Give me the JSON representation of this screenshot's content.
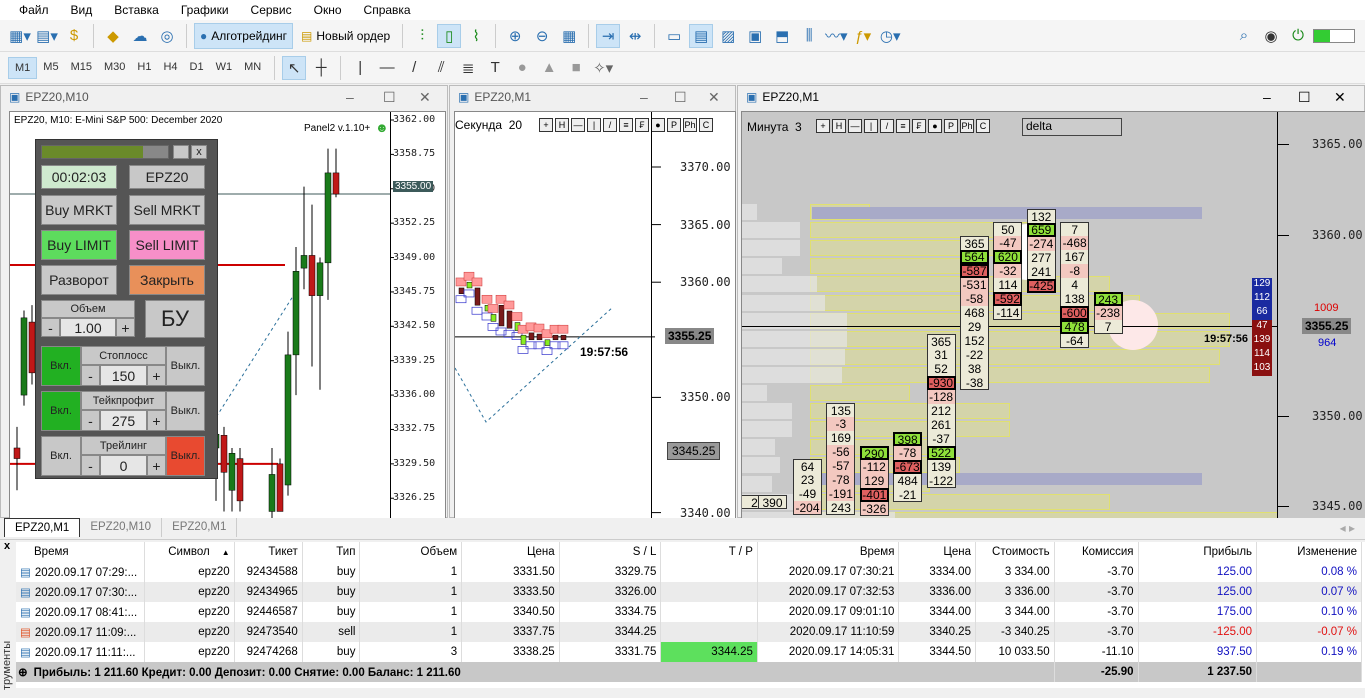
{
  "menu": [
    "Файл",
    "Вид",
    "Вставка",
    "Графики",
    "Сервис",
    "Окно",
    "Справка"
  ],
  "toolbar": {
    "algo_label": "Алготрейдинг",
    "new_order_label": "Новый ордер"
  },
  "timeframes": [
    "M1",
    "M5",
    "M15",
    "M30",
    "H1",
    "H4",
    "D1",
    "W1",
    "MN"
  ],
  "windows": [
    {
      "title": "EPZ20,M10",
      "chart_caption": "EPZ20, M10:  E-Mini S&P 500: December 2020",
      "panel_label": "Panel2 v.1.10+",
      "axis": [
        "3362.00",
        "3358.75",
        "3355.50",
        "3352.25",
        "3349.00",
        "3345.75",
        "3342.50",
        "3339.25",
        "3336.00",
        "3332.75",
        "3329.50",
        "3326.25"
      ],
      "price_tag": "3355.00",
      "candles": [
        [
          3331,
          3333,
          3327,
          3330
        ],
        [
          3336,
          3344,
          3335,
          3343.3
        ],
        [
          3342.9,
          3344.5,
          3337,
          3338.1
        ],
        [
          3331,
          3333,
          3326,
          3332.3
        ],
        [
          3332.2,
          3333,
          3325,
          3328.7
        ],
        [
          3327,
          3331,
          3325,
          3330.5
        ],
        [
          3330,
          3331,
          3325,
          3326
        ],
        [
          3325,
          3331,
          3324,
          3328.5
        ],
        [
          3329.5,
          3330,
          3325,
          3325
        ],
        [
          3327.5,
          3342,
          3326.5,
          3339.8
        ],
        [
          3339.8,
          3350,
          3336,
          3347.7
        ],
        [
          3348,
          3355.7,
          3346,
          3349.2
        ],
        [
          3349.2,
          3354,
          3338.7,
          3345.4
        ],
        [
          3345.4,
          3349,
          3336.5,
          3348.5
        ],
        [
          3348.5,
          3359.3,
          3345,
          3357
        ],
        [
          3357,
          3359.3,
          3354.7,
          3355
        ]
      ]
    },
    {
      "title": "EPZ20,M1",
      "mode_label": "Секунда",
      "mode_value": "20",
      "axis": [
        "3370.00",
        "3365.00",
        "3360.00",
        "3350.00",
        "3340.00"
      ],
      "price_tag": "3355.25",
      "tag2": "3345.25",
      "time": "19:57:56"
    },
    {
      "title": "EPZ20,M1",
      "mode_label": "Минута",
      "mode_value": "3",
      "delta_label": "delta",
      "axis": [
        "3365.00",
        "3360.00",
        "3350.00",
        "3345.00"
      ],
      "price_tag": "3355.25",
      "time": "19:57:56",
      "ask_vol": [
        "129",
        "112",
        "66"
      ],
      "bid_vol": [
        "47",
        "139",
        "114",
        "103"
      ],
      "ask_total": "1009",
      "bid_total": "964"
    }
  ],
  "tool_buttons": [
    "+",
    "H",
    "—",
    "|",
    "/",
    "≡",
    "₣",
    "●",
    "P",
    "Ph",
    "C"
  ],
  "panel": {
    "timer": "00:02:03",
    "symbol": "EPZ20",
    "buy_mrkt": "Buy MRKT",
    "sell_mrkt": "Sell MRKT",
    "buy_limit": "Buy LIMIT",
    "sell_limit": "Sell LIMIT",
    "reverse": "Разворот",
    "close": "Закрыть",
    "volume_label": "Объем",
    "volume": "1.00",
    "be": "БУ",
    "minus": "-",
    "plus": "+",
    "x": "x",
    "rows": [
      {
        "label": "Стоплосс",
        "value": "150",
        "on": "Вкл.",
        "off": "Выкл."
      },
      {
        "label": "Тейкпрофит",
        "value": "275",
        "on": "Вкл.",
        "off": "Выкл."
      },
      {
        "label": "Трейлинг",
        "value": "0",
        "on": "Вкл.",
        "off": "Выкл."
      }
    ]
  },
  "footprint": [
    {
      "top": 3345.6,
      "cells": [
        [
          "2",
          "n"
        ]
      ]
    },
    {
      "top": 3345.6,
      "cells": [
        [
          "390",
          "n"
        ]
      ]
    },
    {
      "top": 3347.6,
      "cells": [
        [
          "64",
          "n"
        ],
        [
          "23",
          "n"
        ],
        [
          "-49",
          "n"
        ],
        [
          "-204",
          "lr"
        ]
      ]
    },
    {
      "top": 3350.7,
      "cells": [
        [
          "135",
          "n"
        ],
        [
          "-3",
          "lr"
        ],
        [
          "169",
          "n"
        ],
        [
          "-56",
          "lr"
        ],
        [
          "-57",
          "lr"
        ],
        [
          "-78",
          "lr"
        ],
        [
          "-191",
          "lr"
        ],
        [
          "243",
          "n"
        ]
      ]
    },
    {
      "top": 3348.3,
      "cells": [
        [
          "290",
          "g"
        ],
        [
          "-112",
          "lr"
        ],
        [
          "129",
          "lr"
        ],
        [
          "-401",
          "r"
        ],
        [
          "-326",
          "lr"
        ]
      ]
    },
    {
      "top": 3349.1,
      "cells": [
        [
          "398",
          "g"
        ],
        [
          "-78",
          "lr"
        ],
        [
          "-673",
          "r"
        ],
        [
          "484",
          "n"
        ],
        [
          "-21",
          "n"
        ]
      ]
    },
    {
      "top": 3354.5,
      "cells": [
        [
          "365",
          "n"
        ],
        [
          "31",
          "n"
        ],
        [
          "52",
          "n"
        ],
        [
          "-930",
          "r"
        ],
        [
          "-128",
          "lr"
        ],
        [
          "212",
          "n"
        ],
        [
          "261",
          "n"
        ],
        [
          "-37",
          "n"
        ],
        [
          "522",
          "g"
        ],
        [
          "139",
          "n"
        ],
        [
          "-122",
          "n"
        ]
      ]
    },
    {
      "top": 3359.9,
      "cells": [
        [
          "365",
          "n"
        ],
        [
          "564",
          "g"
        ],
        [
          "-587",
          "r"
        ],
        [
          "-531",
          "lr"
        ],
        [
          "-58",
          "lr"
        ],
        [
          "468",
          "n"
        ],
        [
          "29",
          "n"
        ],
        [
          "152",
          "n"
        ],
        [
          "-22",
          "n"
        ],
        [
          "38",
          "n"
        ],
        [
          "-38",
          "n"
        ]
      ]
    },
    {
      "top": 3360.7,
      "cells": [
        [
          "50",
          "n"
        ],
        [
          "-47",
          "lr"
        ],
        [
          "620",
          "g"
        ],
        [
          "-32",
          "lr"
        ],
        [
          "114",
          "n"
        ],
        [
          "-592",
          "r"
        ],
        [
          "-114",
          "n"
        ]
      ]
    },
    {
      "top": 3361.4,
      "cells": [
        [
          "132",
          "n"
        ],
        [
          "659",
          "g"
        ],
        [
          "-274",
          "lr"
        ],
        [
          "277",
          "n"
        ],
        [
          "241",
          "n"
        ],
        [
          "-425",
          "r"
        ]
      ]
    },
    {
      "top": 3360.7,
      "cells": [
        [
          "7",
          "n"
        ],
        [
          "-468",
          "lr"
        ],
        [
          "167",
          "n"
        ],
        [
          "-8",
          "lr"
        ],
        [
          "4",
          "n"
        ],
        [
          "138",
          "n"
        ],
        [
          "-600",
          "r"
        ],
        [
          "478",
          "g"
        ],
        [
          "-64",
          "n"
        ]
      ]
    },
    {
      "top": 3356.8,
      "cells": [
        [
          "243",
          "g"
        ],
        [
          "-238",
          "lr"
        ],
        [
          "7",
          "n"
        ]
      ]
    }
  ],
  "bottom_tabs": [
    "EPZ20,M1",
    "EPZ20,M10",
    "EPZ20,M1"
  ],
  "table": {
    "headers": [
      "Время",
      "Символ",
      "Тикет",
      "Тип",
      "Объем",
      "Цена",
      "S / L",
      "T / P",
      "Время",
      "Цена",
      "Стоимость",
      "Комиссия",
      "Прибыль",
      "Изменение"
    ],
    "rows": [
      [
        "2020.09.17 07:29:...",
        "epz20",
        "92434588",
        "buy",
        "1",
        "3331.50",
        "3329.75",
        "",
        "2020.09.17 07:30:21",
        "3334.00",
        "3 334.00",
        "-3.70",
        "125.00",
        "0.08 %"
      ],
      [
        "2020.09.17 07:30:...",
        "epz20",
        "92434965",
        "buy",
        "1",
        "3333.50",
        "3326.00",
        "",
        "2020.09.17 07:32:53",
        "3336.00",
        "3 336.00",
        "-3.70",
        "125.00",
        "0.07 %"
      ],
      [
        "2020.09.17 08:41:...",
        "epz20",
        "92446587",
        "buy",
        "1",
        "3340.50",
        "3334.75",
        "",
        "2020.09.17 09:01:10",
        "3344.00",
        "3 344.00",
        "-3.70",
        "175.00",
        "0.10 %"
      ],
      [
        "2020.09.17 11:09:...",
        "epz20",
        "92473540",
        "sell",
        "1",
        "3337.75",
        "3344.25",
        "",
        "2020.09.17 11:10:59",
        "3340.25",
        "-3 340.25",
        "-3.70",
        "-125.00",
        "-0.07 %"
      ],
      [
        "2020.09.17 11:11:...",
        "epz20",
        "92474268",
        "buy",
        "3",
        "3338.25",
        "3331.75",
        "3344.25",
        "2020.09.17 14:05:31",
        "3344.50",
        "10 033.50",
        "-11.10",
        "937.50",
        "0.19 %"
      ]
    ],
    "summary": "Прибыль: 1 211.60  Кредит: 0.00  Депозит: 0.00  Снятие: 0.00  Баланс: 1 211.60",
    "total_commission": "-25.90",
    "total_profit": "1 237.50"
  },
  "side_label": "трументы"
}
